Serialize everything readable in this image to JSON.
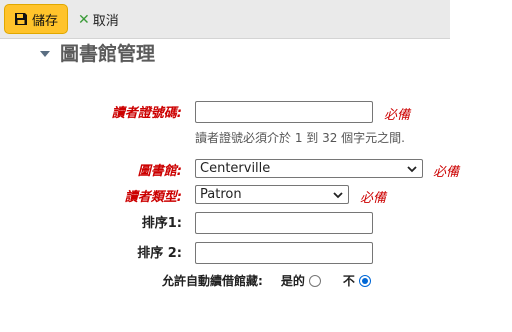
{
  "toolbar": {
    "save_label": "儲存",
    "cancel_label": "取消",
    "save_icon": "floppy-disk-icon",
    "cancel_icon": "x-icon"
  },
  "section": {
    "title": "圖書館管理"
  },
  "form": {
    "cardnumber": {
      "label": "讀者證號碼:",
      "value": "",
      "required_text": "必備",
      "hint": "讀者證號必須介於 1 到 32 個字元之間."
    },
    "library": {
      "label": "圖書館:",
      "selected": "Centerville",
      "required_text": "必備"
    },
    "category": {
      "label": "讀者類型:",
      "selected": "Patron",
      "required_text": "必備"
    },
    "sort1": {
      "label": "排序1:",
      "value": ""
    },
    "sort2": {
      "label": "排序 2:",
      "value": ""
    },
    "autorenew": {
      "label": "允許自動續借館藏:",
      "yes_label": "是的",
      "no_label": "不",
      "selected": "no"
    }
  },
  "colors": {
    "save_button": "#ffc32b",
    "required": "#cc0000",
    "toolbar_bg": "#eaeaea",
    "cancel_icon": "#3a9b38",
    "radio_accent": "#0067d6"
  }
}
